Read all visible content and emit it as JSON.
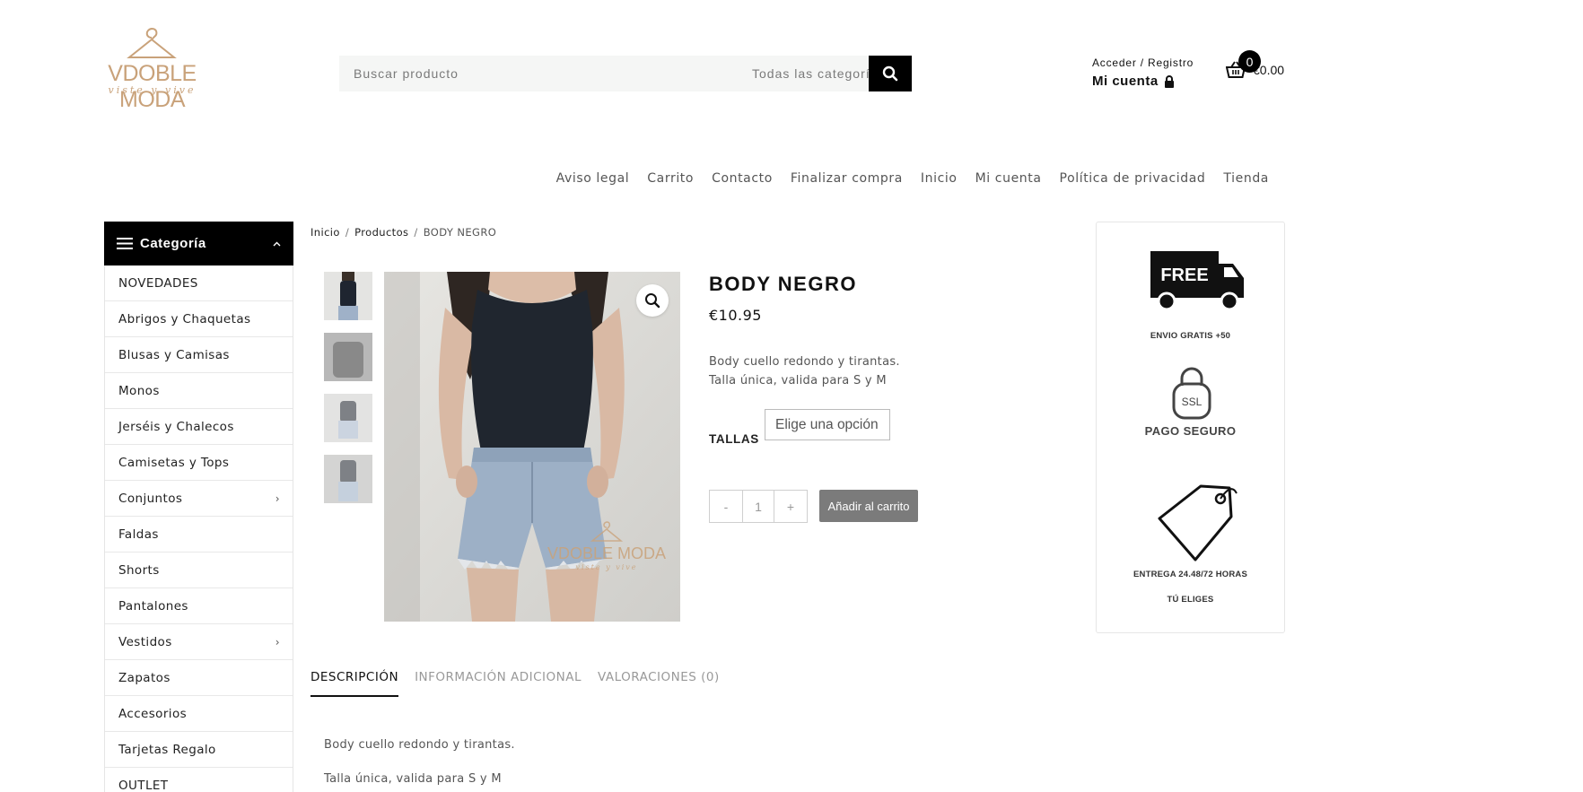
{
  "header": {
    "logo_text": "VDOBLE MODA",
    "logo_tagline": "viste y vive",
    "search_placeholder": "Buscar producto",
    "search_category": "Todas las categorías",
    "account_top": "Acceder / Registro",
    "account_main": "Mi cuenta",
    "cart_count": "0",
    "cart_total": "€0.00"
  },
  "topnav": [
    "Aviso legal",
    "Carrito",
    "Contacto",
    "Finalizar compra",
    "Inicio",
    "Mi cuenta",
    "Política de privacidad",
    "Tienda"
  ],
  "sidebar": {
    "title": "Categoría",
    "items": [
      {
        "label": "NOVEDADES",
        "sub": false
      },
      {
        "label": "Abrigos y Chaquetas",
        "sub": false
      },
      {
        "label": "Blusas y Camisas",
        "sub": false
      },
      {
        "label": "Monos",
        "sub": false
      },
      {
        "label": "Jerséis y Chalecos",
        "sub": false
      },
      {
        "label": "Camisetas y Tops",
        "sub": false
      },
      {
        "label": "Conjuntos",
        "sub": true
      },
      {
        "label": "Faldas",
        "sub": false
      },
      {
        "label": "Shorts",
        "sub": false
      },
      {
        "label": "Pantalones",
        "sub": false
      },
      {
        "label": "Vestidos",
        "sub": true
      },
      {
        "label": "Zapatos",
        "sub": false
      },
      {
        "label": "Accesorios",
        "sub": false
      },
      {
        "label": "Tarjetas Regalo",
        "sub": false
      },
      {
        "label": "OUTLET",
        "sub": false
      }
    ]
  },
  "breadcrumb": {
    "home": "Inicio",
    "section": "Productos",
    "current": "BODY NEGRO"
  },
  "product": {
    "title": "BODY NEGRO",
    "price": "€10.95",
    "desc_line1": "Body cuello redondo y tirantas.",
    "desc_line2": "Talla única, valida para S y M",
    "sizes_label": "TALLAS",
    "sizes_placeholder": "Elige una opción",
    "qty_minus": "-",
    "qty_value": "1",
    "qty_plus": "+",
    "add_to_cart": "Añadir al carrito",
    "image_watermark": "VDOBLE MODA",
    "image_watermark_tag": "viste y vive"
  },
  "banner": {
    "free_label": "FREE",
    "free_caption": "ENVIO GRATIS +50",
    "ssl_label": "SSL",
    "secure_caption": "PAGO SEGURO",
    "delivery_caption": "ENTREGA 24.48/72 HORAS",
    "delivery_sub": "TÚ ELIGES"
  },
  "tabs": {
    "items": [
      "DESCRIPCIÓN",
      "INFORMACIÓN ADICIONAL",
      "VALORACIONES (0)"
    ],
    "active": 0,
    "body_line1": "Body cuello redondo y tirantas.",
    "body_line2": "Talla única, valida para S y M"
  }
}
